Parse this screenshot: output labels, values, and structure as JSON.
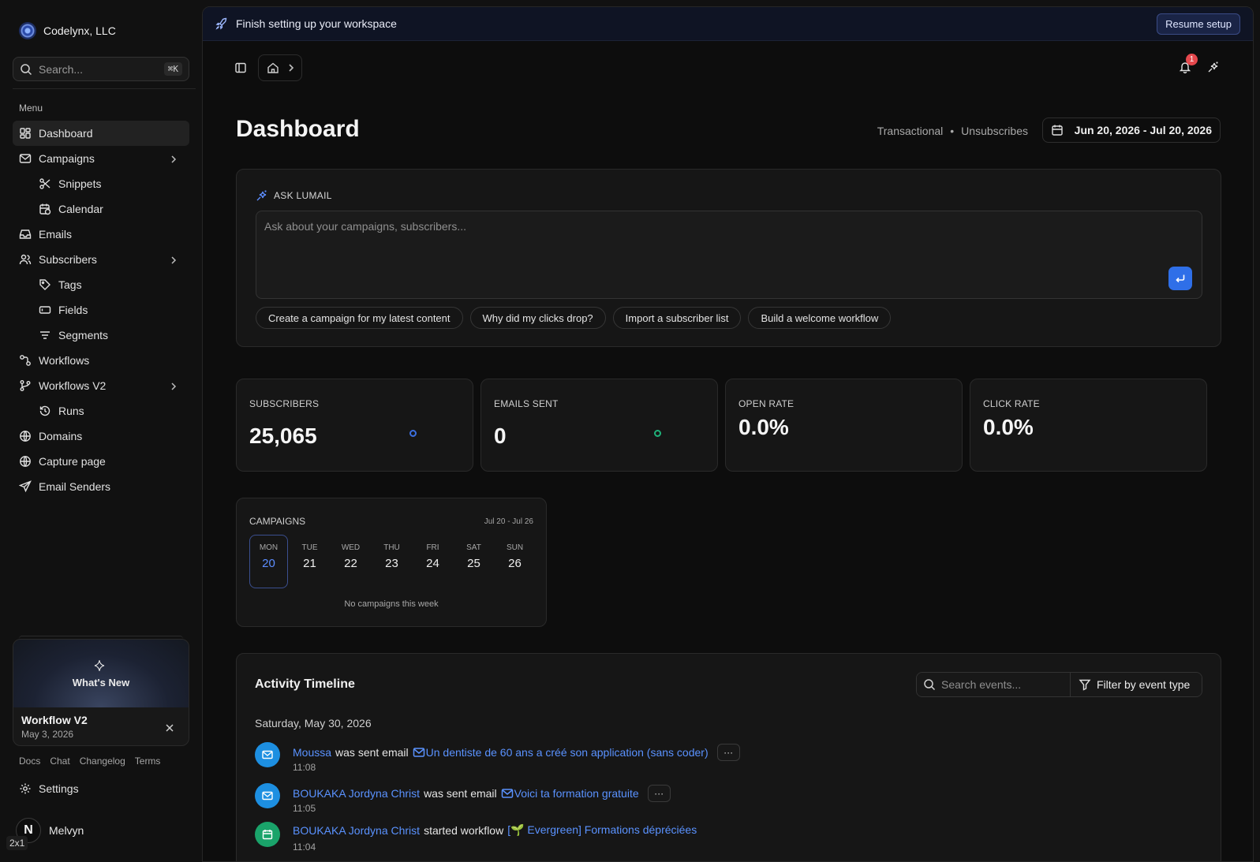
{
  "sidebar": {
    "org_name": "Codelynx, LLC",
    "search_placeholder": "Search...",
    "search_shortcut": "⌘K",
    "menu_label": "Menu",
    "items": [
      {
        "label": "Dashboard",
        "icon": "dashboard-icon"
      },
      {
        "label": "Campaigns",
        "icon": "mail-icon"
      },
      {
        "label": "Snippets",
        "icon": "scissors-icon"
      },
      {
        "label": "Calendar",
        "icon": "calendar-clock-icon"
      },
      {
        "label": "Emails",
        "icon": "inbox-icon"
      },
      {
        "label": "Subscribers",
        "icon": "users-icon"
      },
      {
        "label": "Tags",
        "icon": "tag-icon"
      },
      {
        "label": "Fields",
        "icon": "field-icon"
      },
      {
        "label": "Segments",
        "icon": "filter-lines-icon"
      },
      {
        "label": "Workflows",
        "icon": "workflow-icon"
      },
      {
        "label": "Workflows V2",
        "icon": "git-branch-icon"
      },
      {
        "label": "Runs",
        "icon": "history-icon"
      },
      {
        "label": "Domains",
        "icon": "globe-icon"
      },
      {
        "label": "Capture page",
        "icon": "globe-icon"
      },
      {
        "label": "Email Senders",
        "icon": "send-icon"
      }
    ],
    "whats_new": {
      "banner": "What's New",
      "title": "Workflow V2",
      "date": "May 3, 2026"
    },
    "footer_links": [
      "Docs",
      "Chat",
      "Changelog",
      "Terms"
    ],
    "settings_label": "Settings",
    "user": {
      "initial": "N",
      "name": "Melvyn"
    },
    "scale_badge": "2x1"
  },
  "banner": {
    "text": "Finish setting up your workspace",
    "button": "Resume setup"
  },
  "notifications": {
    "count": "1"
  },
  "page": {
    "title": "Dashboard",
    "filters": [
      "Transactional",
      "Unsubscribes"
    ],
    "date_range": "Jun 20, 2026 - Jul 20, 2026"
  },
  "ask": {
    "label": "ASK LUMAIL",
    "placeholder": "Ask about your campaigns, subscribers...",
    "chips": [
      "Create a campaign for my latest content",
      "Why did my clicks drop?",
      "Import a subscriber list",
      "Build a welcome workflow"
    ]
  },
  "stats": [
    {
      "label": "SUBSCRIBERS",
      "value": "25,065"
    },
    {
      "label": "EMAILS SENT",
      "value": "0"
    },
    {
      "label": "OPEN RATE",
      "value": "0.0%"
    },
    {
      "label": "CLICK RATE",
      "value": "0.0%"
    }
  ],
  "campaigns": {
    "label": "CAMPAIGNS",
    "range": "Jul 20 - Jul 26",
    "days": [
      {
        "name": "MON",
        "num": "20"
      },
      {
        "name": "TUE",
        "num": "21"
      },
      {
        "name": "WED",
        "num": "22"
      },
      {
        "name": "THU",
        "num": "23"
      },
      {
        "name": "FRI",
        "num": "24"
      },
      {
        "name": "SAT",
        "num": "25"
      },
      {
        "name": "SUN",
        "num": "26"
      }
    ],
    "empty": "No campaigns this week"
  },
  "activity": {
    "title": "Activity Timeline",
    "search_placeholder": "Search events...",
    "filter_label": "Filter by event type",
    "date": "Saturday, May 30, 2026",
    "events": [
      {
        "actor": "Moussa",
        "action": "was sent email",
        "target": "Un dentiste de 60 ans a créé son application (sans coder)",
        "time": "11:08",
        "more": "···"
      },
      {
        "actor": "BOUKAKA Jordyna Christ",
        "action": "was sent email",
        "target": "Voici ta formation gratuite",
        "time": "11:05",
        "more": "···"
      },
      {
        "actor": "BOUKAKA Jordyna Christ",
        "action": "started workflow",
        "target": "[🌱 Evergreen] Formations dépréciées",
        "time": "11:04"
      }
    ]
  },
  "colors": {
    "accent": "#2f6fe8",
    "link": "#5a92ff",
    "email_event": "#1d8fe1",
    "workflow_event": "#1aa36a",
    "notif": "#e5484d"
  }
}
